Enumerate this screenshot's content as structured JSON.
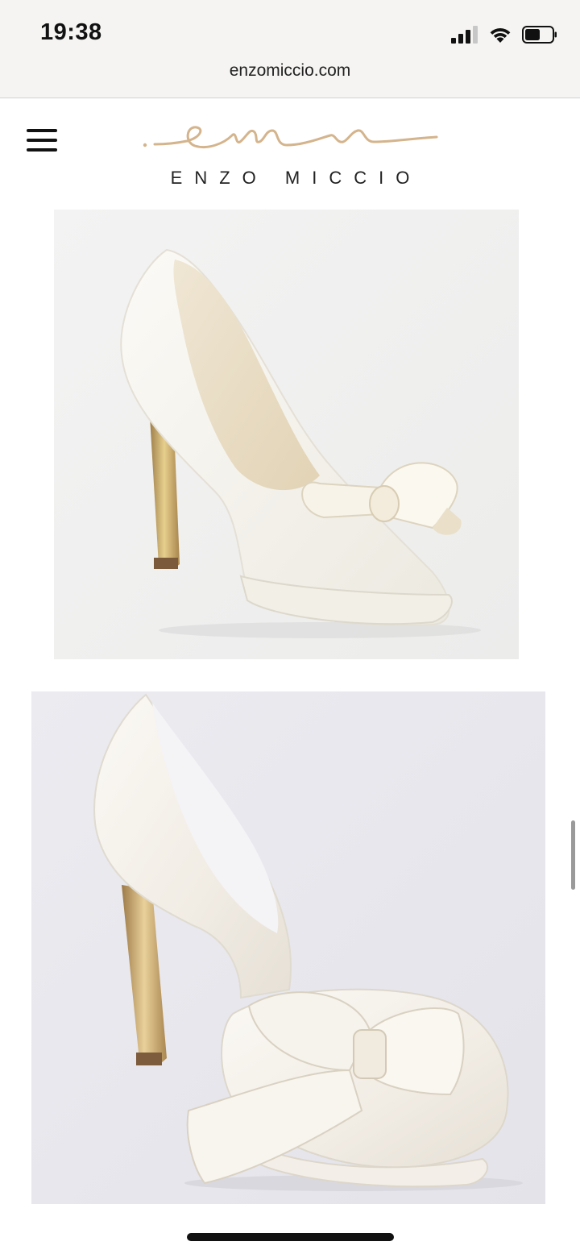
{
  "status_bar": {
    "time": "19:38"
  },
  "browser": {
    "url": "enzomiccio.com"
  },
  "site": {
    "brand_name": "ENZO MICCIO",
    "menu_icon": "hamburger-menu-icon",
    "logo_icon": "enzo-miccio-signature-logo",
    "accent_color": "#d4b48c"
  },
  "products": [
    {
      "image": "ivory-lace-platform-pump-with-satin-bow",
      "background": "#efefef"
    },
    {
      "image": "ivory-satin-dorsay-pump-with-lace-bow",
      "background": "#e7e6ec"
    }
  ]
}
